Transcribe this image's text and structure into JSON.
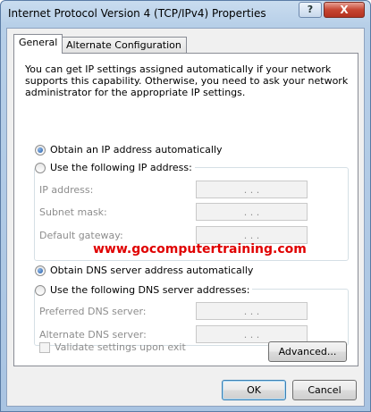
{
  "window": {
    "title": "Internet Protocol Version 4 (TCP/IPv4) Properties",
    "help_label": "?",
    "close_label": "X"
  },
  "tabs": [
    {
      "label": "General",
      "active": true
    },
    {
      "label": "Alternate Configuration",
      "active": false
    }
  ],
  "description": "You can get IP settings assigned automatically if your network supports this capability. Otherwise, you need to ask your network administrator for the appropriate IP settings.",
  "ip_section": {
    "auto_label": "Obtain an IP address automatically",
    "manual_label": "Use the following IP address:",
    "selected": "auto",
    "fields": [
      {
        "label": "IP address:",
        "value": ". . ."
      },
      {
        "label": "Subnet mask:",
        "value": ". . ."
      },
      {
        "label": "Default gateway:",
        "value": ". . ."
      }
    ]
  },
  "watermark": "www.gocomputertraining.com",
  "dns_section": {
    "auto_label": "Obtain DNS server address automatically",
    "manual_label": "Use the following DNS server addresses:",
    "selected": "auto",
    "fields": [
      {
        "label": "Preferred DNS server:",
        "value": ". . ."
      },
      {
        "label": "Alternate DNS server:",
        "value": ". . ."
      }
    ]
  },
  "validate_label": "Validate settings upon exit",
  "buttons": {
    "advanced": "Advanced...",
    "ok": "OK",
    "cancel": "Cancel"
  },
  "colors": {
    "watermark": "#e00000",
    "radio_selected": "#1e5aa8",
    "close_button": "#c64532"
  }
}
